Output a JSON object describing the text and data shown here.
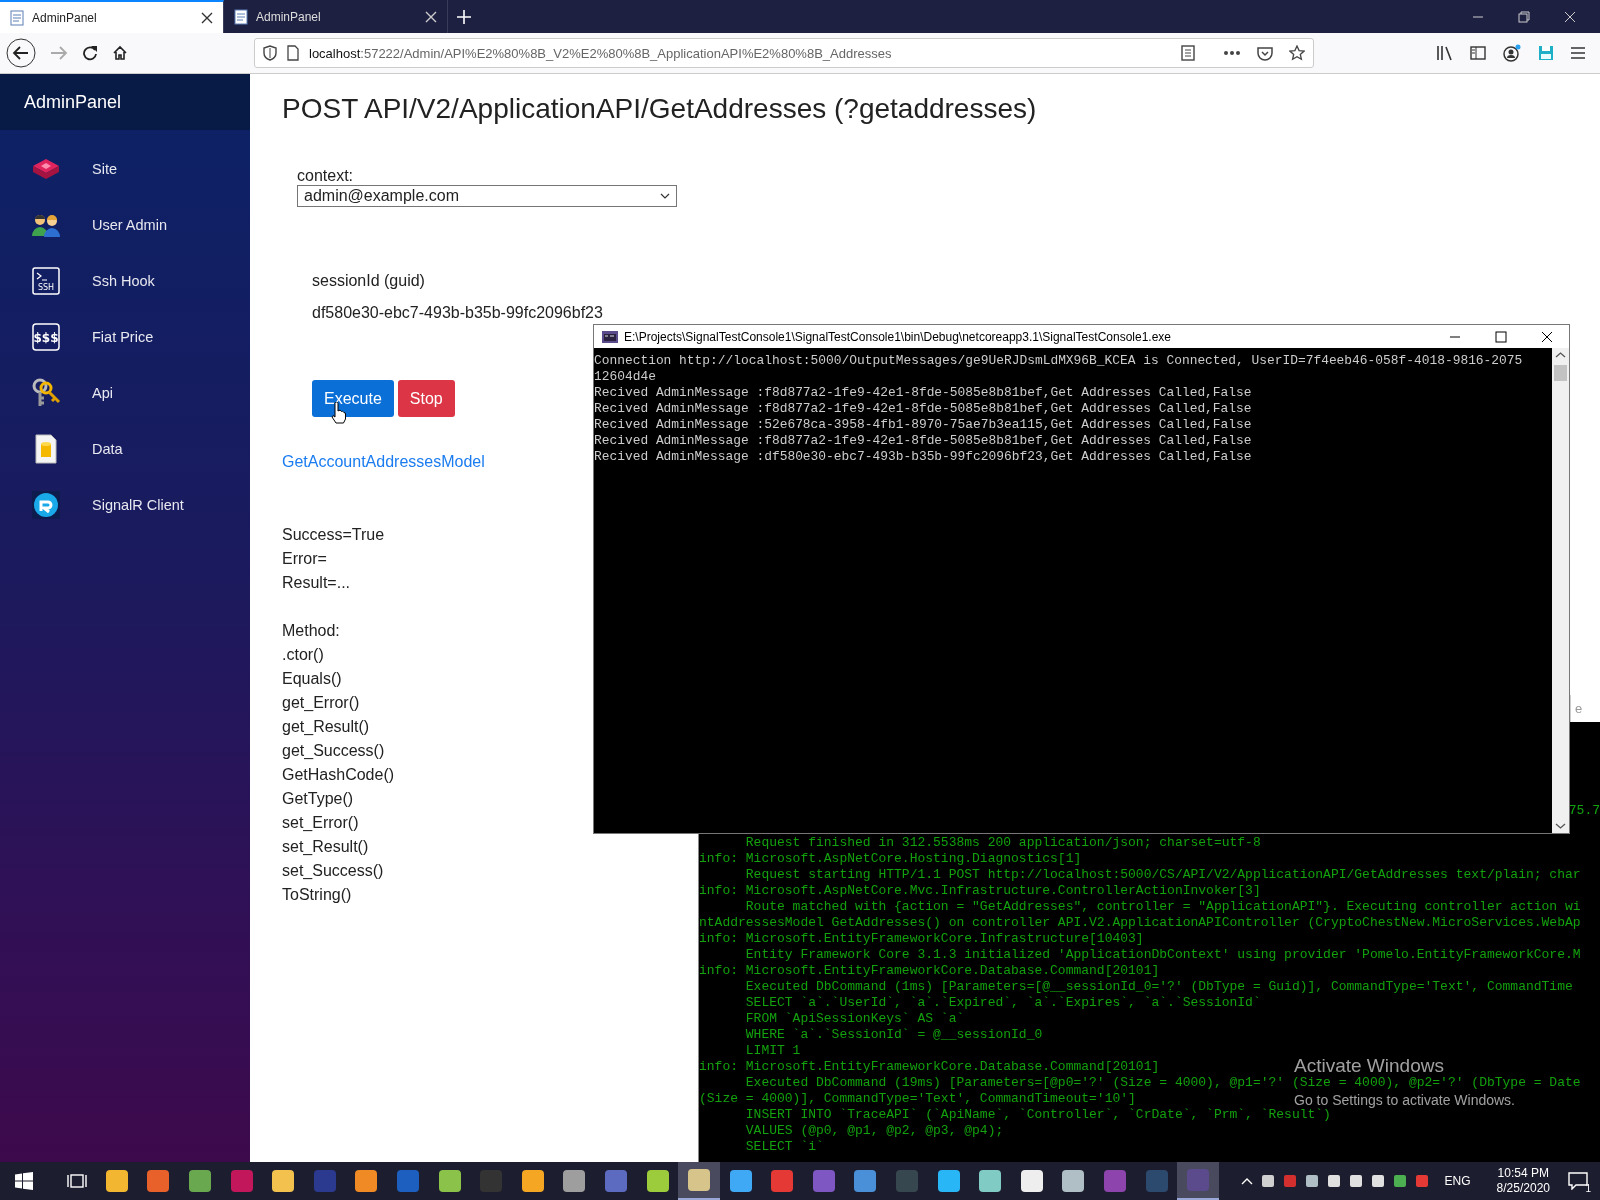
{
  "browser": {
    "tabs": [
      {
        "title": "AdminPanel",
        "selected": true
      },
      {
        "title": "AdminPanel",
        "selected": false
      }
    ],
    "nav": {
      "back_disabled": false,
      "forward_disabled": true
    },
    "url_host": "localhost",
    "url_rest": ":57222/Admin/API%E2%80%8B_V2%E2%80%8B_ApplicationAPI%E2%80%8B_Addresses"
  },
  "sidebar": {
    "brand": "AdminPanel",
    "items": [
      {
        "label": "Site",
        "kind": "cube"
      },
      {
        "label": "User Admin",
        "kind": "users"
      },
      {
        "label": "Ssh Hook",
        "kind": "terminal",
        "icon_text": "SSH"
      },
      {
        "label": "Fiat Price",
        "kind": "steam",
        "icon_text": "$$$"
      },
      {
        "label": "Api",
        "kind": "keys"
      },
      {
        "label": "Data",
        "kind": "database"
      },
      {
        "label": "SignalR Client",
        "kind": "refresh"
      }
    ]
  },
  "page": {
    "title": "POST API/V2/ApplicationAPI/GetAddresses (?getaddresses)",
    "context_label": "context:",
    "context_value": "admin@example.com",
    "param_label": "sessionId (guid)",
    "param_value": "df580e30-ebc7-493b-b35b-99fc2096bf23",
    "buttons": [
      {
        "label": "Execute",
        "kind": "primary"
      },
      {
        "label": "Stop",
        "kind": "danger"
      }
    ],
    "model_link": "GetAccountAddressesModel",
    "result_lines": [
      "Success=True",
      "Error=",
      "Result=..."
    ],
    "methods_label": "Method:",
    "methods": [
      ".ctor()",
      "Equals()",
      "get_Error()",
      "get_Result()",
      "get_Success()",
      "GetHashCode()",
      "GetType()",
      "set_Error()",
      "set_Result()",
      "set_Success()",
      "ToString()"
    ]
  },
  "background_window": {
    "fragment_text": "e",
    "cut_text": "75.7",
    "lines": [
      "      Request finished in 312.5538ms 200 application/json; charset=utf-8",
      "info: Microsoft.AspNetCore.Hosting.Diagnostics[1]",
      "      Request starting HTTP/1.1 POST http://localhost:5000/CS/API/V2/ApplicationAPI/GetAddresses text/plain; char",
      "info: Microsoft.AspNetCore.Mvc.Infrastructure.ControllerActionInvoker[3]",
      "      Route matched with {action = \"GetAddresses\", controller = \"ApplicationAPI\"}. Executing controller action wi",
      "ntAddressesModel GetAddresses() on controller API.V2.ApplicationAPIController (CryptoChestNew.MicroServices.WebAp",
      "info: Microsoft.EntityFrameworkCore.Infrastructure[10403]",
      "      Entity Framework Core 3.1.3 initialized 'ApplicationDbContext' using provider 'Pomelo.EntityFrameworkCore.M",
      "info: Microsoft.EntityFrameworkCore.Database.Command[20101]",
      "      Executed DbCommand (1ms) [Parameters=[@__sessionId_0='?' (DbType = Guid)], CommandType='Text', CommandTime",
      "      SELECT `a`.`UserId`, `a`.`Expired`, `a`.`Expires`, `a`.`SessionId`",
      "      FROM `ApiSessionKeys` AS `a`",
      "      WHERE `a`.`SessionId` = @__sessionId_0",
      "      LIMIT 1",
      "info: Microsoft.EntityFrameworkCore.Database.Command[20101]",
      "      Executed DbCommand (19ms) [Parameters=[@p0='?' (Size = 4000), @p1='?' (Size = 4000), @p2='?' (DbType = Date",
      "(Size = 4000)], CommandType='Text', CommandTimeout='10']",
      "      INSERT INTO `TraceAPI` (`ApiName`, `Controller`, `CrDate`, `Prm`, `Result`)",
      "      VALUES (@p0, @p1, @p2, @p3, @p4);",
      "      SELECT `i`"
    ]
  },
  "console_window": {
    "title": "E:\\Projects\\SignalTestConsole1\\SignalTestConsole1\\bin\\Debug\\netcoreapp3.1\\SignalTestConsole1.exe",
    "lines": [
      "Connection http://localhost:5000/OutputMessages/ge9UeRJDsmLdMX96B_KCEA is Connected, UserID=7f4eeb46-058f-4018-9816-2075",
      "12604d4e",
      "Recived AdminMessage :f8d877a2-1fe9-42e1-8fde-5085e8b81bef,Get Addresses Called,False",
      "Recived AdminMessage :f8d877a2-1fe9-42e1-8fde-5085e8b81bef,Get Addresses Called,False",
      "Recived AdminMessage :52e678ca-3958-4fb1-8970-75ae7b3ea115,Get Addresses Called,False",
      "Recived AdminMessage :f8d877a2-1fe9-42e1-8fde-5085e8b81bef,Get Addresses Called,False",
      "Recived AdminMessage :df580e30-ebc7-493b-b35b-99fc2096bf23,Get Addresses Called,False"
    ]
  },
  "activation": {
    "title": "Activate Windows",
    "subtitle": "Go to Settings to activate Windows."
  },
  "taskbar": {
    "apps": [
      {
        "color": "#f2b630",
        "selected": false
      },
      {
        "color": "#e8602a",
        "selected": false
      },
      {
        "color": "#6aa84f",
        "selected": false
      },
      {
        "color": "#c2185b",
        "selected": false
      },
      {
        "color": "#f2c14e",
        "selected": false
      },
      {
        "color": "#2b3a8f",
        "selected": false
      },
      {
        "color": "#f08a24",
        "selected": false
      },
      {
        "color": "#1c5fbf",
        "selected": false
      },
      {
        "color": "#8bc34a",
        "selected": false
      },
      {
        "color": "#333333",
        "selected": false
      },
      {
        "color": "#f5a623",
        "selected": false
      },
      {
        "color": "#9e9e9e",
        "selected": false
      },
      {
        "color": "#5c6bc0",
        "selected": false
      },
      {
        "color": "#9ccc3c",
        "selected": false
      },
      {
        "color": "#d7c48a",
        "selected": true
      },
      {
        "color": "#3fa9f5",
        "selected": false
      },
      {
        "color": "#e53935",
        "selected": false
      },
      {
        "color": "#7e57c2",
        "selected": false
      },
      {
        "color": "#4a90d9",
        "selected": false
      },
      {
        "color": "#37474f",
        "selected": false
      },
      {
        "color": "#29b6f6",
        "selected": false
      },
      {
        "color": "#80cbc4",
        "selected": false
      },
      {
        "color": "#eeeeee",
        "selected": false
      },
      {
        "color": "#b0bec5",
        "selected": false
      },
      {
        "color": "#8e44ad",
        "selected": false
      },
      {
        "color": "#2c4a6e",
        "selected": false
      },
      {
        "color": "#5b4a8c",
        "selected": true
      }
    ],
    "tray": [
      {
        "color": "#cfcfcf"
      },
      {
        "color": "#d32f2f"
      },
      {
        "color": "#b0bec5"
      },
      {
        "color": "#e0e0e0"
      },
      {
        "color": "#e0e0e0"
      },
      {
        "color": "#e0e0e0"
      },
      {
        "color": "#4caf50"
      },
      {
        "color": "#e53935"
      }
    ],
    "language": "ENG",
    "time": "10:54 PM",
    "date": "8/25/2020",
    "notifications": "1"
  }
}
